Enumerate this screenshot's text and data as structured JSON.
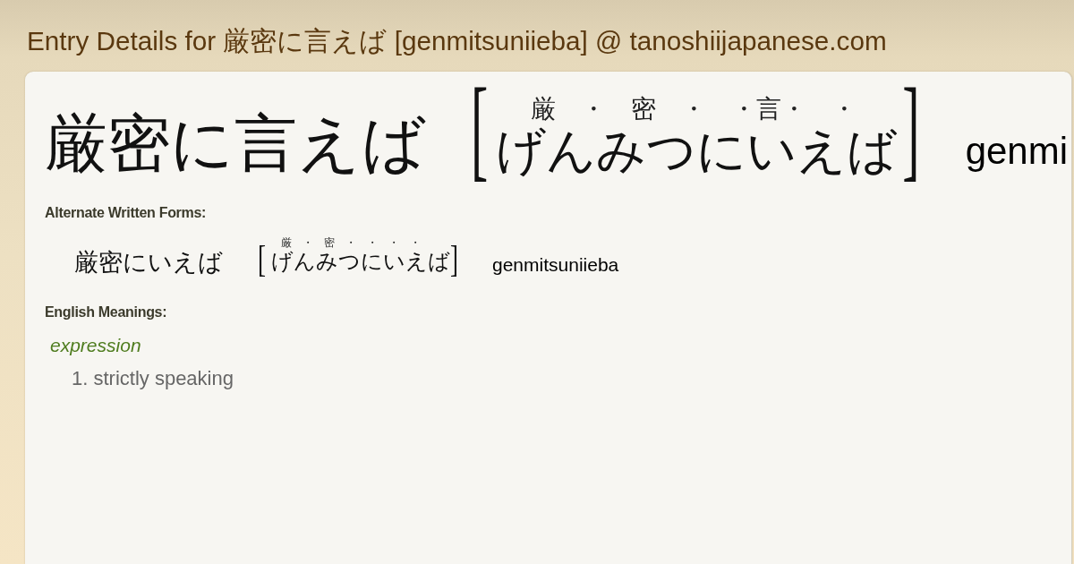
{
  "page": {
    "title": "Entry Details for 厳密に言えば [genmitsuniieba] @ tanoshiijapanese.com"
  },
  "entry": {
    "headword": "厳密に言えば",
    "open_bracket": "[",
    "furigana": "厳　・　密　・　・言・　・",
    "reading": "げんみつにいえば",
    "close_bracket": "]",
    "romaji": "genmi"
  },
  "alternate_forms": {
    "heading": "Alternate Written Forms:",
    "forms": [
      {
        "written": "厳密にいえば",
        "open_bracket": "[",
        "furigana": "厳　・　密　・　・　・　・",
        "reading": "げんみつにいえば",
        "close_bracket": "]",
        "romaji": "genmitsuniieba"
      }
    ]
  },
  "meanings": {
    "heading": "English Meanings:",
    "senses": [
      {
        "part_of_speech": "expression",
        "glosses": [
          "1. strictly speaking"
        ]
      }
    ]
  }
}
